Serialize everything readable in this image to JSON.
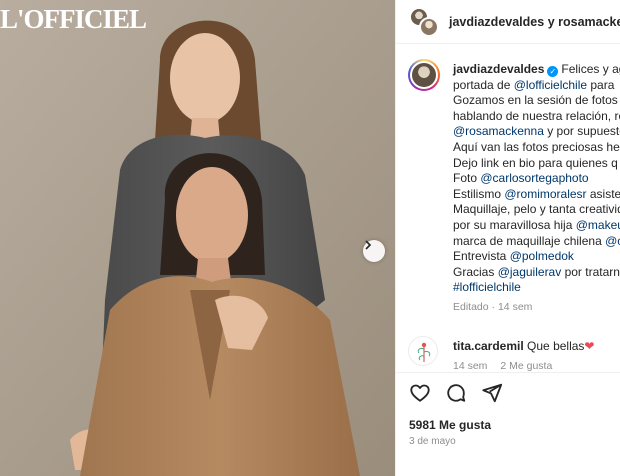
{
  "photo": {
    "magazine_logo": "L'OFFICIEL"
  },
  "header": {
    "user1": "javdiazdevaldes",
    "joiner": "y",
    "user2": "rosamackenna"
  },
  "caption": {
    "username": "javdiazdevaldes",
    "lines": [
      {
        "text": "Felices y agradecidas de ser",
        "tail": ""
      },
      {
        "pre": "portada de ",
        "mention": "@lofficielchile",
        "post": " para"
      },
      {
        "text": "Gozamos en la sesión de fotos y"
      },
      {
        "text": "hablando de nuestra relación, re"
      },
      {
        "mention": "@rosamackenna",
        "post": " y por supuesto"
      },
      {
        "text": "Aquí van las fotos preciosas hec"
      },
      {
        "text": "Dejo link en bio para quienes q"
      },
      {
        "pre": "Foto ",
        "mention": "@carlosortegaphoto",
        "post": ""
      },
      {
        "pre": "Estilismo ",
        "mention": "@romimoralesr",
        "post": " asiste"
      },
      {
        "text": "Maquillaje, pelo y tanta creativid"
      },
      {
        "pre": "por su maravillosa hija ",
        "mention": "@makeu",
        "post": ""
      },
      {
        "pre": "marca de maquillaje chilena ",
        "mention": "@c",
        "post": ""
      },
      {
        "pre": "Entrevista ",
        "mention": "@polmedok",
        "post": ""
      },
      {
        "pre": "Gracias ",
        "mention": "@jaguilerav",
        "post": " por tratarno"
      },
      {
        "pre": "",
        "mention": "#lofficielchile",
        "post": ""
      }
    ],
    "meta_edited": "Editado",
    "meta_sep": " · ",
    "meta_time": "14 sem"
  },
  "comment": {
    "username": "tita.cardemil",
    "text": "Que bellas",
    "emoji": "❤",
    "time": "14 sem",
    "likes": "2 Me gusta"
  },
  "post_footer": {
    "likes": "5981 Me gusta",
    "date": "3 de mayo"
  },
  "colors": {
    "accent_blue": "#0095f6",
    "mention": "#00376b",
    "heart": "#ed4956"
  }
}
